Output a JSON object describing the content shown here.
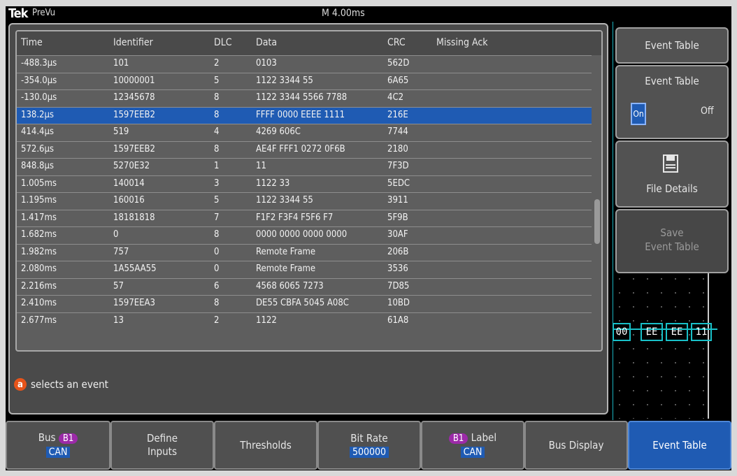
{
  "header": {
    "logo": "Tek",
    "app": "PreVu",
    "timebase": "M 4.00ms"
  },
  "table": {
    "columns": [
      "Time",
      "Identifier",
      "DLC",
      "Data",
      "CRC",
      "Missing Ack"
    ],
    "rows": [
      {
        "time": "-488.3µs",
        "id": "101",
        "dlc": "2",
        "data": "0103",
        "crc": "562D",
        "ack": ""
      },
      {
        "time": "-354.0µs",
        "id": "10000001",
        "dlc": "5",
        "data": "1122 3344 55",
        "crc": "6A65",
        "ack": ""
      },
      {
        "time": "-130.0µs",
        "id": "12345678",
        "dlc": "8",
        "data": "1122 3344 5566 7788",
        "crc": "4C2",
        "ack": ""
      },
      {
        "time": "138.2µs",
        "id": "1597EEB2",
        "dlc": "8",
        "data": "FFFF 0000 EEEE 1111",
        "crc": "216E",
        "ack": ""
      },
      {
        "time": "414.4µs",
        "id": "519",
        "dlc": "4",
        "data": "4269 606C",
        "crc": "7744",
        "ack": ""
      },
      {
        "time": "572.6µs",
        "id": "1597EEB2",
        "dlc": "8",
        "data": "AE4F FFF1 0272 0F6B",
        "crc": "2180",
        "ack": ""
      },
      {
        "time": "848.8µs",
        "id": "5270E32",
        "dlc": "1",
        "data": "11",
        "crc": "7F3D",
        "ack": ""
      },
      {
        "time": "1.005ms",
        "id": "140014",
        "dlc": "3",
        "data": "1122 33",
        "crc": "5EDC",
        "ack": ""
      },
      {
        "time": "1.195ms",
        "id": "160016",
        "dlc": "5",
        "data": "1122 3344 55",
        "crc": "3911",
        "ack": ""
      },
      {
        "time": "1.417ms",
        "id": "18181818",
        "dlc": "7",
        "data": "F1F2 F3F4 F5F6 F7",
        "crc": "5F9B",
        "ack": ""
      },
      {
        "time": "1.682ms",
        "id": "0",
        "dlc": "8",
        "data": "0000 0000 0000 0000",
        "crc": "30AF",
        "ack": ""
      },
      {
        "time": "1.982ms",
        "id": "757",
        "dlc": "0",
        "data": "Remote Frame",
        "crc": "206B",
        "ack": ""
      },
      {
        "time": "2.080ms",
        "id": "1A55AA55",
        "dlc": "0",
        "data": "Remote Frame",
        "crc": "3536",
        "ack": ""
      },
      {
        "time": "2.216ms",
        "id": "57",
        "dlc": "6",
        "data": "4568 6065 7273",
        "crc": "7D85",
        "ack": ""
      },
      {
        "time": "2.410ms",
        "id": "1597EEA3",
        "dlc": "8",
        "data": "DE55 CBFA 5045 A08C",
        "crc": "10BD",
        "ack": ""
      },
      {
        "time": "2.677ms",
        "id": "13",
        "dlc": "2",
        "data": "1122",
        "crc": "61A8",
        "ack": ""
      }
    ],
    "selected_index": 3
  },
  "hint": {
    "badge": "a",
    "text": "selects an event"
  },
  "side_menu": {
    "title": "Event Table",
    "toggle_label": "Event Table",
    "on": "On",
    "off": "Off",
    "file_details": "File Details",
    "save_line1": "Save",
    "save_line2": "Event Table"
  },
  "bus_decode": {
    "boxes": [
      "00",
      "EE",
      "EE",
      "11"
    ]
  },
  "bottom_menu": {
    "bus_label": "Bus",
    "bus_tag": "B1",
    "bus_value": "CAN",
    "define_line1": "Define",
    "define_line2": "Inputs",
    "thresholds": "Thresholds",
    "bitrate_label": "Bit Rate",
    "bitrate_value": "500000",
    "label_tag": "B1",
    "label_label": "Label",
    "label_value": "CAN",
    "bus_display": "Bus Display",
    "event_table": "Event Table"
  },
  "colors": {
    "selection": "#1f5bb3",
    "bus_tag": "#9c2aa8",
    "bus_trace": "#19c0c8",
    "hint_badge": "#e8541a"
  }
}
